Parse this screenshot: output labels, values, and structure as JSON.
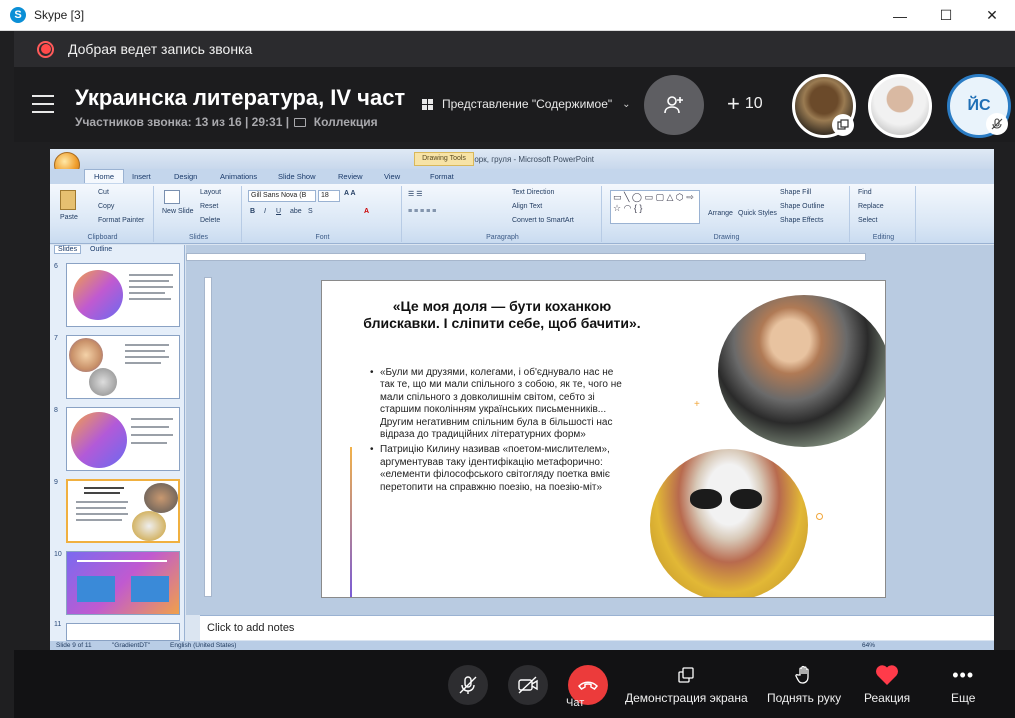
{
  "window": {
    "app_title": "Skype [3]",
    "logo_letter": "S",
    "minimize": "—",
    "maximize": "☐",
    "close": "✕"
  },
  "recording": {
    "text": "Добрая ведет запись звонка",
    "color": "#ff4a4a"
  },
  "call": {
    "title": "Украинска литература, IV част",
    "subtitle": "Участников звонка: 13 из 16 | 29:31 |",
    "collection": "Коллекция",
    "view_mode": "Представление \"Содержимое\"",
    "extra_participants": "10",
    "avatar_initials": "ЙС"
  },
  "powerpoint": {
    "window_title": "Нью-Йорк, груля - Microsoft PowerPoint",
    "contextual_tab": "Drawing Tools",
    "tabs": [
      "Home",
      "Insert",
      "Design",
      "Animations",
      "Slide Show",
      "Review",
      "View",
      "Format"
    ],
    "ribbon": {
      "clipboard": {
        "label": "Clipboard",
        "paste": "Paste",
        "cut": "Cut",
        "copy": "Copy",
        "format_painter": "Format Painter"
      },
      "slides": {
        "label": "Slides",
        "new_slide": "New Slide",
        "layout": "Layout",
        "reset": "Reset",
        "delete": "Delete"
      },
      "font": {
        "label": "Font",
        "name": "Gill Sans Nova (B",
        "size": "18"
      },
      "paragraph": {
        "label": "Paragraph",
        "text_direction": "Text Direction",
        "align_text": "Align Text",
        "convert": "Convert to SmartArt"
      },
      "drawing": {
        "label": "Drawing",
        "arrange": "Arrange",
        "quick_styles": "Quick Styles",
        "shape_fill": "Shape Fill",
        "shape_outline": "Shape Outline",
        "shape_effects": "Shape Effects"
      },
      "editing": {
        "label": "Editing",
        "find": "Find",
        "replace": "Replace",
        "select": "Select"
      }
    },
    "pane_tabs": [
      "Slides",
      "Outline"
    ],
    "thumbnails": [
      "6",
      "7",
      "8",
      "9",
      "10",
      "11"
    ],
    "slide": {
      "title": "«Це моя доля — бути коханкою блискавки. І сліпити себе, щоб бачити».",
      "bullet1": "«Були ми друзями, колегами, і об'єднувало нас не так те, що ми мали спільного з собою, як те, чого не мали спільного з довколишнім світом, себто зі старшим поколінням українських письменників... Другим негативним спільним була в більшості нас відраза до традиційних літературних форм»",
      "bullet2": "Патрицію Килину називав «поетом-мислителем», аргументував таку ідентифікацію метафорично: «елементи філософського світогляду поетка вміє перетопити на справжню поезію, на поезію-міт»"
    },
    "notes_placeholder": "Click to add notes",
    "status": {
      "slide": "Slide 9 of 11",
      "theme": "\"GradientDT\"",
      "language": "English (United States)",
      "zoom": "64%"
    }
  },
  "controls": {
    "chat": "Чат",
    "share_screen": "Демонстрация экрана",
    "raise_hand": "Поднять руку",
    "reaction": "Реакция",
    "more": "Еще",
    "end_call_color": "#ec3b3b",
    "reaction_color": "#ff3b4a"
  }
}
